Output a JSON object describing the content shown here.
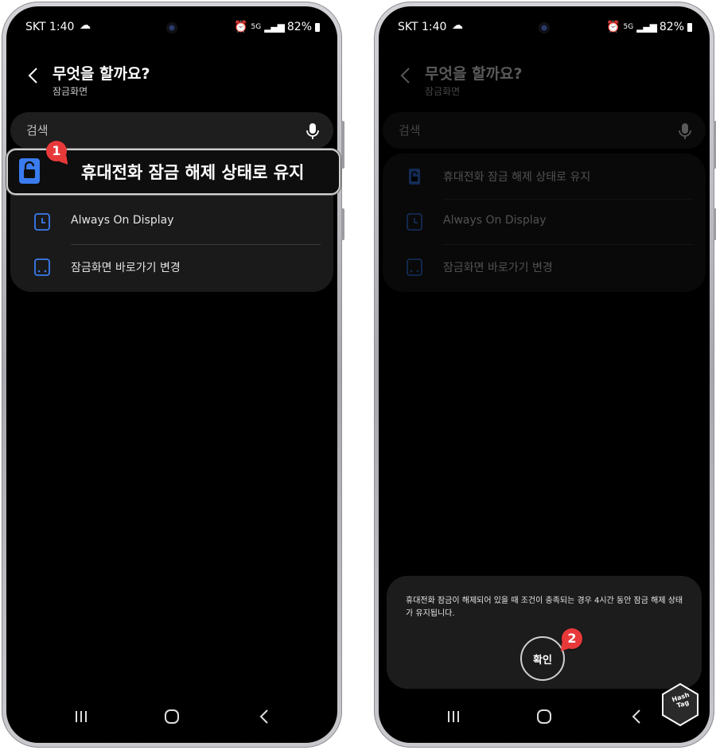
{
  "status": {
    "carrier_time": "SKT 1:40",
    "network": "5G",
    "battery": "82%"
  },
  "header": {
    "title": "무엇을 할까요?",
    "subtitle": "잠금화면"
  },
  "search": {
    "placeholder": "검색"
  },
  "list": {
    "items": [
      {
        "label": "휴대전화 잠금 해제 상태로 유지",
        "icon": "lock-icon"
      },
      {
        "label": "Always On Display",
        "icon": "clock-icon"
      },
      {
        "label": "잠금화면 바로가기 변경",
        "icon": "shortcut-icon"
      }
    ]
  },
  "highlight": {
    "label": "휴대전화 잠금 해제 상태로 유지"
  },
  "dialog": {
    "message": "휴대전화 잠금이 해제되어 있을 때 조건이 충족되는 경우 4시간 동안 잠금 해제 상태가 유지됩니다.",
    "confirm_label": "확인"
  },
  "annotations": {
    "step1": "1",
    "step2": "2"
  },
  "logo": {
    "line1": "Hash",
    "line2": "Tag"
  },
  "colors": {
    "accent_blue": "#3a7cf0",
    "badge_red": "#e8393a",
    "screen_bg": "#000000",
    "card_bg": "#1a1a1a"
  }
}
